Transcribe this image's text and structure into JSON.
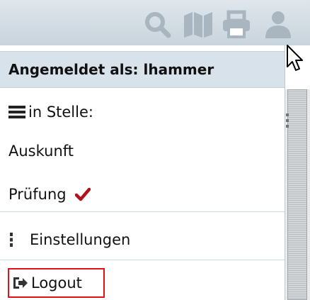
{
  "toolbar": {
    "icons": [
      "search-icon",
      "map-icon",
      "print-icon",
      "user-icon"
    ],
    "icon_color": "#a9b6bf"
  },
  "user_menu": {
    "header_label": "Angemeldet als: lhammer",
    "stelle_label": "in Stelle:",
    "stelle_options": [
      {
        "label": "Auskunft",
        "selected": false
      },
      {
        "label": "Prüfung",
        "selected": true
      }
    ],
    "settings_label": "Einstellungen",
    "logout_label": "Logout"
  },
  "colors": {
    "header_bg": "#d7e2ea",
    "check": "#b0121d",
    "highlight_border": "#e3101b"
  }
}
